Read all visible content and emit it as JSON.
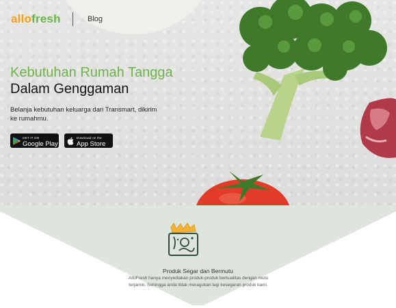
{
  "header": {
    "logo_part1": "allo",
    "logo_part2": "fresh",
    "nav_blog": "Blog"
  },
  "hero": {
    "headline_line1": "Kebutuhan Rumah Tangga",
    "headline_line2": "Dalam Genggaman",
    "subtext": "Belanja kebutuhan keluarga dari Transmart, dikirim ke rumahmu."
  },
  "store_buttons": {
    "google_small": "GET IT ON",
    "google_big": "Google Play",
    "apple_small": "Download on the",
    "apple_big": "App Store"
  },
  "feature": {
    "title": "Produk Segar dan Bermutu",
    "description": "AlloFresh hanya menyediakan produk-produk berkualitas dengan mutu terjamin. Sehingga anda tidak meragukan lagi kesegaran produk kami."
  },
  "colors": {
    "brand_green": "#6db34a",
    "brand_orange": "#f2a21a",
    "mint_background": "#dde5dc"
  },
  "icons": {
    "google_play": "google-play-icon",
    "apple": "apple-icon",
    "grocery_bag": "grocery-bag-icon"
  }
}
